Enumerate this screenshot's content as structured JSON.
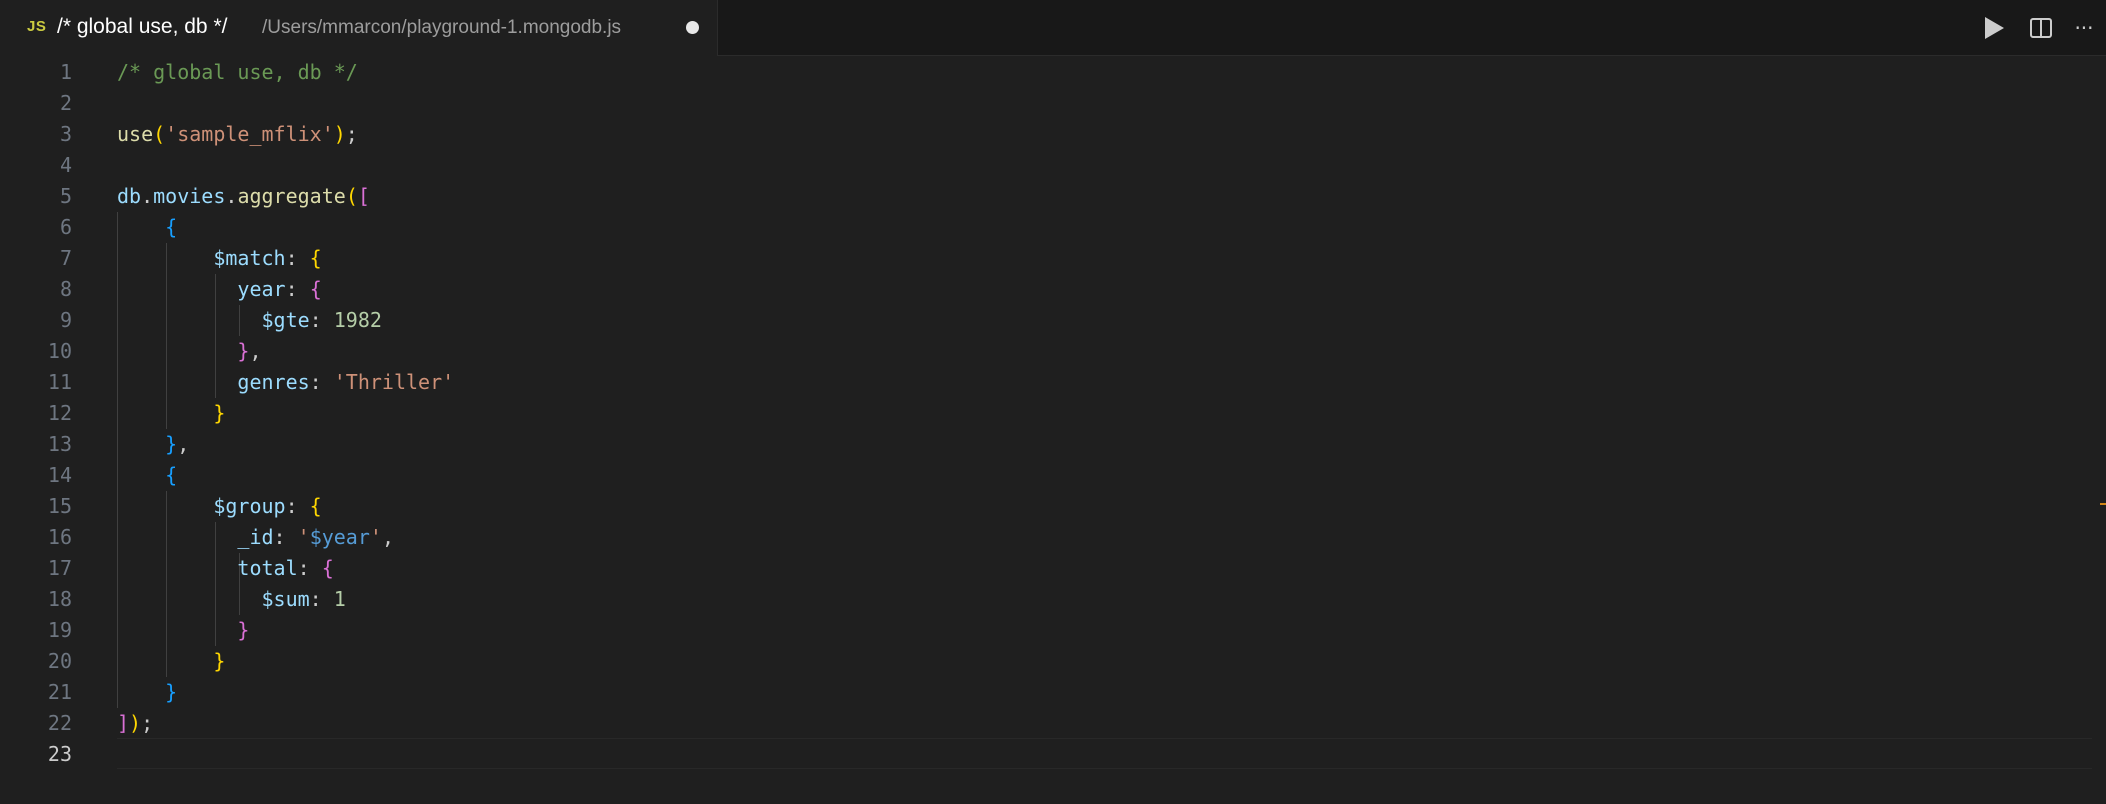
{
  "tab": {
    "icon_label": "JS",
    "title": "/* global use, db */",
    "path": "/Users/mmarcon/playground-1.mongodb.js"
  },
  "actions": [
    {
      "name": "run-icon"
    },
    {
      "name": "split-editor-icon"
    },
    {
      "name": "more-actions-icon",
      "label": "···"
    }
  ],
  "editor": {
    "active_line": 23,
    "lines": [
      {
        "n": "1",
        "tokens": [
          {
            "t": "/* global use, db */",
            "c": "cmt"
          }
        ]
      },
      {
        "n": "2",
        "tokens": []
      },
      {
        "n": "3",
        "tokens": [
          {
            "t": "use",
            "c": "fn"
          },
          {
            "t": "(",
            "c": "b1"
          },
          {
            "t": "'sample_mflix'",
            "c": "str"
          },
          {
            "t": ")",
            "c": "b1"
          },
          {
            "t": ";",
            "c": ""
          }
        ]
      },
      {
        "n": "4",
        "tokens": []
      },
      {
        "n": "5",
        "tokens": [
          {
            "t": "db",
            "c": "var"
          },
          {
            "t": ".",
            "c": ""
          },
          {
            "t": "movies",
            "c": "var"
          },
          {
            "t": ".",
            "c": ""
          },
          {
            "t": "aggregate",
            "c": "fn"
          },
          {
            "t": "(",
            "c": "b1"
          },
          {
            "t": "[",
            "c": "b2"
          }
        ]
      },
      {
        "n": "6",
        "tokens": [
          {
            "t": "    ",
            "c": ""
          },
          {
            "t": "{",
            "c": "b3"
          }
        ]
      },
      {
        "n": "7",
        "tokens": [
          {
            "t": "        ",
            "c": ""
          },
          {
            "t": "$match",
            "c": "var"
          },
          {
            "t": ": ",
            "c": ""
          },
          {
            "t": "{",
            "c": "b1"
          }
        ]
      },
      {
        "n": "8",
        "tokens": [
          {
            "t": "          ",
            "c": ""
          },
          {
            "t": "year",
            "c": "var"
          },
          {
            "t": ": ",
            "c": ""
          },
          {
            "t": "{",
            "c": "b2"
          }
        ]
      },
      {
        "n": "9",
        "tokens": [
          {
            "t": "            ",
            "c": ""
          },
          {
            "t": "$gte",
            "c": "var"
          },
          {
            "t": ": ",
            "c": ""
          },
          {
            "t": "1982",
            "c": "num"
          }
        ]
      },
      {
        "n": "10",
        "tokens": [
          {
            "t": "          ",
            "c": ""
          },
          {
            "t": "}",
            "c": "b2"
          },
          {
            "t": ",",
            "c": ""
          }
        ]
      },
      {
        "n": "11",
        "tokens": [
          {
            "t": "          ",
            "c": ""
          },
          {
            "t": "genres",
            "c": "var"
          },
          {
            "t": ": ",
            "c": ""
          },
          {
            "t": "'Thriller'",
            "c": "str"
          }
        ]
      },
      {
        "n": "12",
        "tokens": [
          {
            "t": "        ",
            "c": ""
          },
          {
            "t": "}",
            "c": "b1"
          }
        ]
      },
      {
        "n": "13",
        "tokens": [
          {
            "t": "    ",
            "c": ""
          },
          {
            "t": "}",
            "c": "b3"
          },
          {
            "t": ",",
            "c": ""
          }
        ]
      },
      {
        "n": "14",
        "tokens": [
          {
            "t": "    ",
            "c": ""
          },
          {
            "t": "{",
            "c": "b3"
          }
        ]
      },
      {
        "n": "15",
        "tokens": [
          {
            "t": "        ",
            "c": ""
          },
          {
            "t": "$group",
            "c": "var"
          },
          {
            "t": ": ",
            "c": ""
          },
          {
            "t": "{",
            "c": "b1"
          }
        ]
      },
      {
        "n": "16",
        "tokens": [
          {
            "t": "          ",
            "c": ""
          },
          {
            "t": "_id",
            "c": "var"
          },
          {
            "t": ": ",
            "c": ""
          },
          {
            "t": "'",
            "c": "str"
          },
          {
            "t": "$year",
            "c": "tmpl"
          },
          {
            "t": "'",
            "c": "str"
          },
          {
            "t": ",",
            "c": ""
          }
        ]
      },
      {
        "n": "17",
        "tokens": [
          {
            "t": "          ",
            "c": ""
          },
          {
            "t": "total",
            "c": "var"
          },
          {
            "t": ": ",
            "c": ""
          },
          {
            "t": "{",
            "c": "b2"
          }
        ]
      },
      {
        "n": "18",
        "tokens": [
          {
            "t": "            ",
            "c": ""
          },
          {
            "t": "$sum",
            "c": "var"
          },
          {
            "t": ": ",
            "c": ""
          },
          {
            "t": "1",
            "c": "num"
          }
        ]
      },
      {
        "n": "19",
        "tokens": [
          {
            "t": "          ",
            "c": ""
          },
          {
            "t": "}",
            "c": "b2"
          }
        ]
      },
      {
        "n": "20",
        "tokens": [
          {
            "t": "        ",
            "c": ""
          },
          {
            "t": "}",
            "c": "b1"
          }
        ]
      },
      {
        "n": "21",
        "tokens": [
          {
            "t": "    ",
            "c": ""
          },
          {
            "t": "}",
            "c": "b3"
          }
        ]
      },
      {
        "n": "22",
        "tokens": [
          {
            "t": "]",
            "c": "b2"
          },
          {
            "t": ")",
            "c": "b1"
          },
          {
            "t": ";",
            "c": ""
          }
        ]
      },
      {
        "n": "23",
        "tokens": []
      }
    ]
  }
}
